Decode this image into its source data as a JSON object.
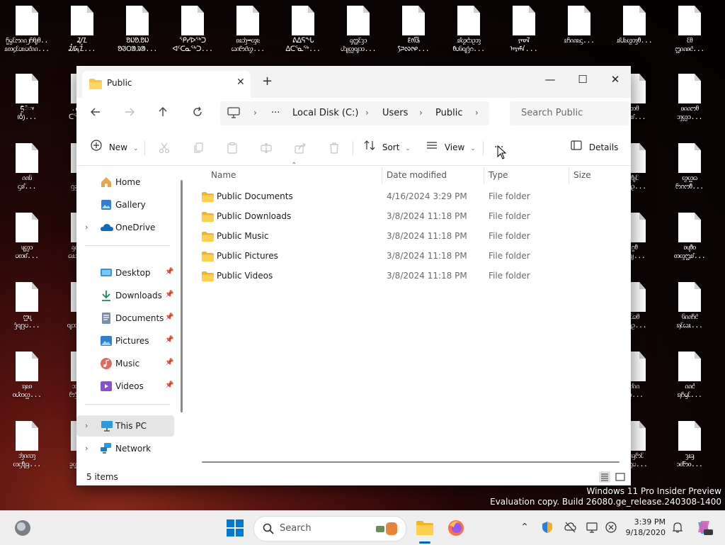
{
  "desktop_icons": [
    {
      "label": "ᦩᧄᦷᦂᦶ᧒ᦆᧀᦲ..\nᦸᦎ᧔ᦷᦢᦰᦢᦺᦶ..."
    },
    {
      "label": "ᮎᮥᮔᮤ\nᮎᮀᮏᮥᮔᮤ..."
    },
    {
      "label": "ᱚᱡᱚᱹᱚᱡ\nᱚᱣᱛᱟᱹᱨᱟ..."
    },
    {
      "label": "ᕿᓯᐅᖅᑐ\nᐊᑦᑕᓇᖅᑐ..."
    },
    {
      "label": "ᦈᦸᦁ➡ᦐᦰ\nᦍᦵᦝᦺᦖ..."
    },
    {
      "label": "ᕕᐃᕌᖓ\nᐃᑕᕐᓇᖅ..."
    },
    {
      "label": "ᧂᦗᦷᦡᦱ\nᦔᦻᦜᦽᦉ..."
    },
    {
      "label": "ᰚᰦᰳᰂᰥᰩ\nᰎᰧᰜᰦᰋ..."
    },
    {
      "label": "ᦾᦖᦺᦱᦳᦀ\nᦹᦢᦑᦽᦤᦅ..."
    },
    {
      "label": "ᠶᠣ᠋ᠯ\nᠠᠷᠠᠮᠠ..."
    },
    {
      "label": "ᦸᦆᦶᦰᦓ..."
    },
    {
      "label": "ᦾᦔᦰᦖᦀᦹ..."
    },
    {
      "label": "ᦷᦲ\nᦗᦶᦈᦺ..."
    },
    {
      "label": "ᰏᰬᰶᰳᰤ\nᰓᰨᰪᰱ..."
    },
    {
      "label": ".ᓯᐅᓯᐅ\nᑕᖅᑐ..."
    },
    {
      "label": "ᦘᦲ\nᦒᦰᦾ..."
    },
    {
      "label": "ᦈᦶᦂᦲ\nᦀᦜᦱ..."
    },
    {
      "label": "ᦶᦑ\nᦓᦾ..."
    },
    {
      "label": "ᦳᦷ\nᦋᦃᦕ..."
    },
    {
      "label": "ᦿᦷ\nᦉᦏᦳ..."
    },
    {
      "label": "ᦖᦛᦒ\nᦝᦅᦂᦹ..."
    },
    {
      "label": "ᦴᦜᦱ\nᦢᦎᦊ..."
    },
    {
      "label": "ᦇᦶᦐᦵᦺ\nᦒᦸᦁᦕ..."
    },
    {
      "label": "ᦨᦹ\nᦗᦽ..."
    },
    {
      "label": "ᦈᦴᦹᦞ\nᦎᦐᦗᦾ..."
    },
    {
      "label": "ᦦᦴ\nᦤᦽᦡᦢ..."
    },
    {
      "label": "ᦫᦝᦳ\nᦽᦘᦗᦳ..."
    },
    {
      "label": "ᦷᦒᦲ\nᦆᦡᦇᦳ..."
    },
    {
      "label": "ᦑᦶᦆᦺ\nᦣᦷᦍᦸ..."
    },
    {
      "label": "ᦣᦰᦈ\nᦞᦔᦎᦛ..."
    },
    {
      "label": "ᦉᦶᦗᦞ\nᦝᦤᦷᦆ..."
    },
    {
      "label": "ᦊᦶ\nᦑᦳ..."
    },
    {
      "label": "ᦶᦺ\nᦣᦆᦙᦷ..."
    },
    {
      "label": "ᦁᦶᦀ\nᦠᦓᦿᦃ..."
    },
    {
      "label": "ᦍᦳ\nᦧᦄᦝ..."
    },
    {
      "label": "ᦶᦃᦝᦷ\nᦈᦸᦗᦢ..."
    },
    {
      "label": "ᦡᦸᦃ\nᦱᦊᦝᦞ..."
    },
    {
      "label": "ᦕᦹ\nᦳᦉᦣ..."
    },
    {
      "label": "ᦊᦹ\nᦡᦘᦵ..."
    },
    {
      "label": "ᦿᦴᦾᦡ\nᦉᦴᦓᦺ..."
    }
  ],
  "window": {
    "tab_title": "Public",
    "minimize_glyph": "—",
    "maximize_glyph": "☐",
    "close_glyph": "✕",
    "tab_close_glyph": "✕",
    "new_tab_glyph": "+"
  },
  "address": {
    "more": "···",
    "crumbs": [
      "Local Disk (C:)",
      "Users",
      "Public"
    ],
    "search_placeholder": "Search Public"
  },
  "toolbar": {
    "new_label": "New",
    "sort_label": "Sort",
    "view_label": "View",
    "more_label": "···",
    "details_label": "Details"
  },
  "sidebar": {
    "top": [
      {
        "label": "Home"
      },
      {
        "label": "Gallery"
      },
      {
        "label": "OneDrive"
      }
    ],
    "pinned": [
      {
        "label": "Desktop"
      },
      {
        "label": "Downloads"
      },
      {
        "label": "Documents"
      },
      {
        "label": "Pictures"
      },
      {
        "label": "Music"
      },
      {
        "label": "Videos"
      }
    ],
    "bottom": [
      {
        "label": "This PC"
      },
      {
        "label": "Network"
      }
    ]
  },
  "columns": {
    "name": "Name",
    "date": "Date modified",
    "type": "Type",
    "size": "Size"
  },
  "files": [
    {
      "name": "Public Documents",
      "date": "4/16/2024 3:29 PM",
      "type": "File folder"
    },
    {
      "name": "Public Downloads",
      "date": "3/8/2024 11:18 PM",
      "type": "File folder"
    },
    {
      "name": "Public Music",
      "date": "3/8/2024 11:18 PM",
      "type": "File folder"
    },
    {
      "name": "Public Pictures",
      "date": "3/8/2024 11:18 PM",
      "type": "File folder"
    },
    {
      "name": "Public Videos",
      "date": "3/8/2024 11:18 PM",
      "type": "File folder"
    }
  ],
  "status": {
    "item_count": "5 items"
  },
  "watermark": {
    "line1": "Windows 11 Pro Insider Preview",
    "line2": "Evaluation copy. Build 26080.ge_release.240308-1400"
  },
  "taskbar": {
    "search_placeholder": "Search",
    "time": "3:39 PM",
    "date": "9/18/2020"
  },
  "colors": {
    "accent": "#0067c0",
    "folder": "#f8c54a",
    "selection": "#e5e5e5"
  }
}
